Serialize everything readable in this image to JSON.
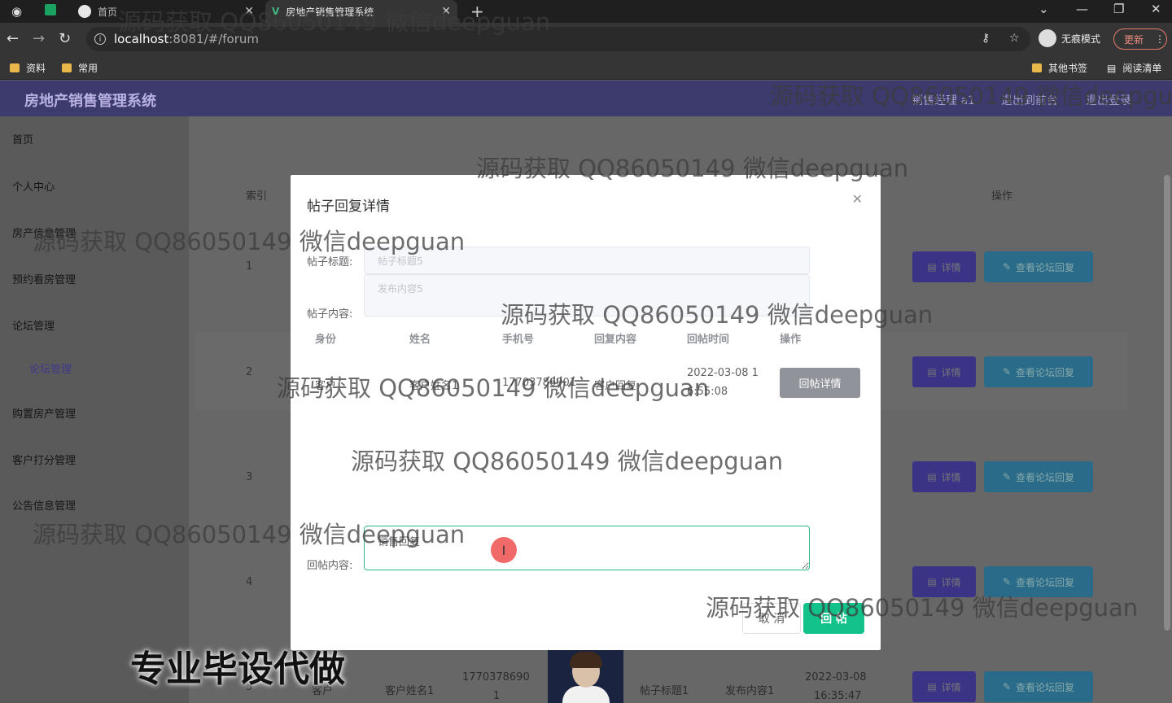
{
  "browser": {
    "tabs": [
      {
        "label": "首页"
      },
      {
        "label": "房地产销售管理系统"
      }
    ],
    "url_host": "localhost",
    "url_path": ":8081/#/forum",
    "incognito_label": "无痕模式",
    "update_label": "更新",
    "bookmarks": [
      "资料",
      "常用"
    ],
    "bookmarks_right": [
      "其他书签",
      "阅读清单"
    ]
  },
  "app": {
    "title": "房地产销售管理系统",
    "header_links": [
      "销售经理 a1",
      "退出到前台",
      "退出登录"
    ]
  },
  "sidebar": {
    "items": [
      {
        "label": "首页"
      },
      {
        "label": "个人中心"
      },
      {
        "label": "房产信息管理"
      },
      {
        "label": "预约看房管理"
      },
      {
        "label": "论坛管理"
      },
      {
        "label": "论坛管理"
      },
      {
        "label": "购置房产管理"
      },
      {
        "label": "客户打分管理"
      },
      {
        "label": "公告信息管理"
      }
    ]
  },
  "table": {
    "headers": {
      "index": "索引",
      "actions": "操作"
    },
    "rows": [
      {
        "index": "1"
      },
      {
        "index": "2"
      },
      {
        "index": "3"
      },
      {
        "index": "4"
      },
      {
        "index": "5",
        "role": "客户",
        "name": "客户姓名1",
        "phone": "1770378690",
        "phone_tail": "1",
        "title": "帖子标题1",
        "content": "发布内容1",
        "date": "2022-03-08",
        "time": "16:35:47"
      }
    ],
    "detail_label": "详情",
    "forum_reply_label": "查看论坛回复"
  },
  "modal": {
    "title": "帖子回复详情",
    "post_title_label": "帖子标题:",
    "post_title_value": "帖子标题5",
    "post_content_label": "帖子内容:",
    "post_content_value": "发布内容5",
    "columns": [
      "身份",
      "姓名",
      "手机号",
      "回复内容",
      "回帖时间",
      "操作"
    ],
    "reply_rows": [
      {
        "role": "客户",
        "name": "客户姓名1",
        "phone": "17703786901",
        "content": "客户回复",
        "time_line1": "2022-03-08 1",
        "time_line2": "6:55:08",
        "action": "回帖详情"
      }
    ],
    "reply_label": "回帖内容:",
    "reply_value": "销售回复",
    "cancel_label": "取 消",
    "submit_label": "回 帖"
  },
  "overlays": {
    "watermark": "源码获取 QQ86050149 微信deepguan",
    "banner": "专业毕设代做"
  }
}
